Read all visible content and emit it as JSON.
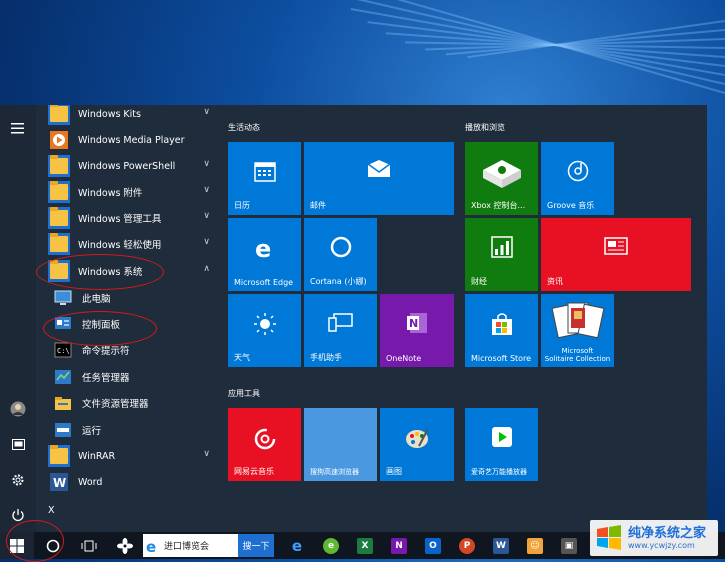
{
  "app_list": [
    {
      "label": "Windows Kits",
      "type": "folder",
      "chevron": "∨"
    },
    {
      "label": "Windows Media Player",
      "type": "media"
    },
    {
      "label": "Windows PowerShell",
      "type": "folder",
      "chevron": "∨"
    },
    {
      "label": "Windows 附件",
      "type": "folder",
      "chevron": "∨"
    },
    {
      "label": "Windows 管理工具",
      "type": "folder",
      "chevron": "∨"
    },
    {
      "label": "Windows 轻松使用",
      "type": "folder",
      "chevron": "∨"
    },
    {
      "label": "Windows 系统",
      "type": "folder",
      "chevron": "∧"
    },
    {
      "label": "此电脑",
      "type": "pc",
      "sub": true
    },
    {
      "label": "控制面板",
      "type": "cp",
      "sub": true
    },
    {
      "label": "命令提示符",
      "type": "cmd",
      "sub": true
    },
    {
      "label": "任务管理器",
      "type": "task",
      "sub": true
    },
    {
      "label": "文件资源管理器",
      "type": "explorer",
      "sub": true
    },
    {
      "label": "运行",
      "type": "run",
      "sub": true
    },
    {
      "label": "WinRAR",
      "type": "folder",
      "chevron": "∨"
    },
    {
      "label": "Word",
      "type": "word"
    },
    {
      "label": "X",
      "type": "letter"
    }
  ],
  "groups": {
    "g1": "生活动态",
    "g2": "播放和浏览",
    "g3": "应用工具"
  },
  "tiles": {
    "calendar": "日历",
    "mail": "邮件",
    "xbox": "Xbox 控制台...",
    "groove": "Groove 音乐",
    "edge": "Microsoft Edge",
    "cortana": "Cortana (小娜)",
    "finance": "财经",
    "news": "资讯",
    "weather": "天气",
    "phone": "手机助手",
    "onenote": "OneNote",
    "store": "Microsoft Store",
    "solitaire": "Microsoft\nSolitaire Collection",
    "netease": "网易云音乐",
    "sogou": "搜狗高速浏览器",
    "paint": "画图",
    "iqiyi": "爱奇艺万能播放器"
  },
  "taskbar": {
    "search_text": "进口博览会",
    "search_button": "搜一下"
  },
  "watermark": {
    "title": "纯净系统之家",
    "url": "www.ycwjzy.com"
  },
  "colors": {
    "tile_blue": "#0078d7",
    "tile_green": "#107c10",
    "tile_red": "#e81123",
    "tile_purple": "#7719aa",
    "annotation_red": "#d31b1b"
  }
}
